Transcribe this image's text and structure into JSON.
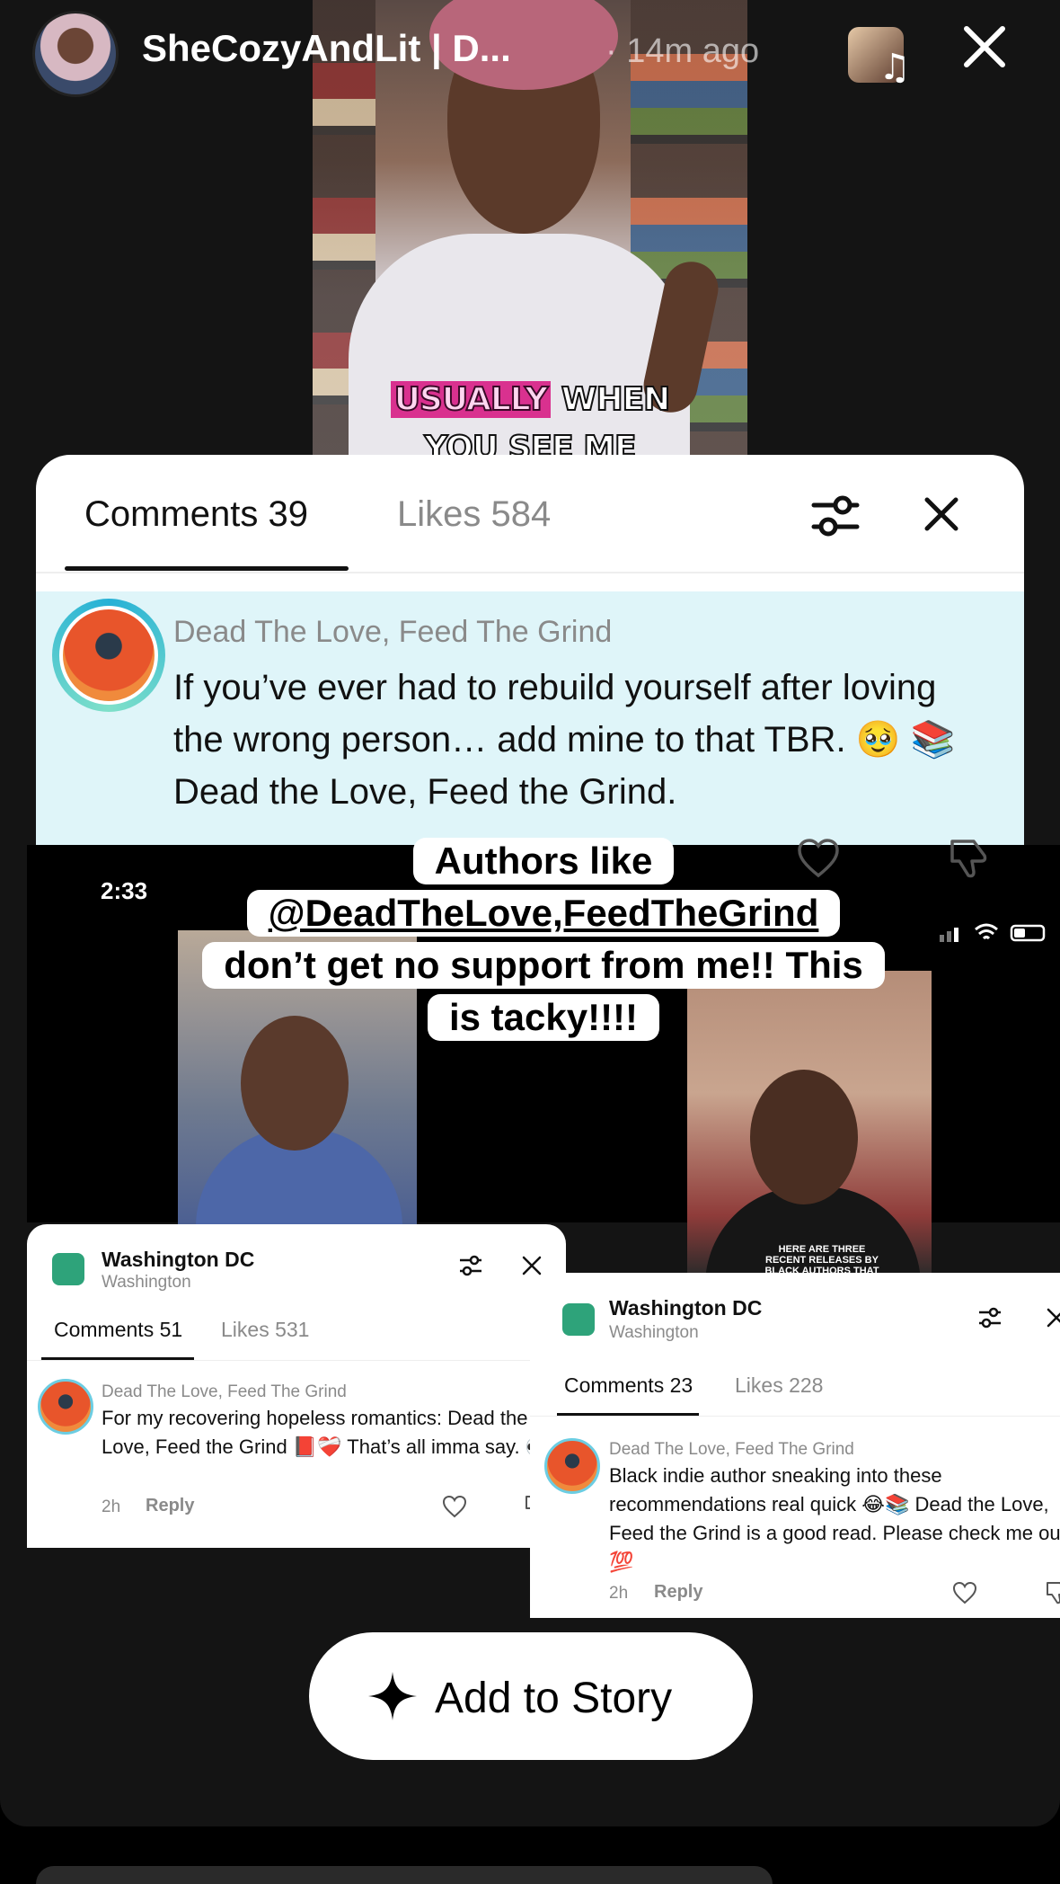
{
  "story": {
    "username": "SheCozyAndLit | D...",
    "time_ago": "· 14m ago",
    "icons": {
      "music": "music-note-icon",
      "close": "close-icon"
    }
  },
  "top_video": {
    "caption_line1_a": "USUALLY",
    "caption_line1_b": "WHEN",
    "caption_line2": "YOU SEE ME"
  },
  "comments_panel": {
    "tab_comments": "Comments 39",
    "tab_likes": "Likes 584",
    "comment": {
      "author": "Dead The Love, Feed The Grind",
      "text": "If you’ve ever had to rebuild yourself after loving the wrong person… add mine to that TBR. 🥹 📚 Dead the Love, Feed the Grind."
    }
  },
  "overlay": {
    "time": "2:33",
    "caption_line1": "Authors like",
    "caption_line2": "@DeadTheLove,FeedTheGrind",
    "caption_line3": "don’t get no support from me!! This",
    "caption_line4": "is tacky!!!!",
    "video2_shirt_text": "HERE ARE THREE RECENT RELEASES BY BLACK AUTHORS THAT FREAKS",
    "panel1": {
      "location": "Washington DC",
      "sub": "Washington",
      "tab_comments": "Comments 51",
      "tab_likes": "Likes 531",
      "author": "Dead The Love, Feed The Grind",
      "text": "For my recovering hopeless romantics: Dead the Love, Feed the Grind 📕❤️‍🩹 That’s all imma say. 👀",
      "age": "2h",
      "reply": "Reply"
    },
    "panel2": {
      "location": "Washington DC",
      "sub": "Washington",
      "tab_comments": "Comments 23",
      "tab_likes": "Likes 228",
      "author": "Dead The Love, Feed The Grind",
      "text": "Black indie author sneaking into these recommendations real quick 😂📚 Dead the Love, Feed the Grind is a good read. Please check me out 💯",
      "age": "2h",
      "reply": "Reply"
    }
  },
  "add_to_story": {
    "label": "Add to Story"
  }
}
